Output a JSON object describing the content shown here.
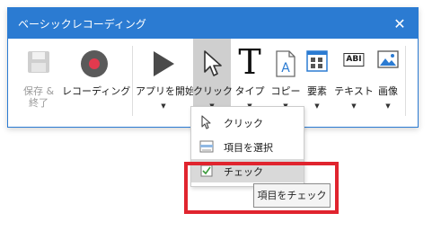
{
  "window": {
    "title": "ベーシックレコーディング",
    "close_glyph": "✕",
    "accent": "#2b7bd2"
  },
  "toolbar": {
    "save_end": {
      "label_1": "保存 &",
      "label_2": "終了",
      "icon": "save-icon",
      "enabled": false
    },
    "recording": {
      "label": "レコーディング",
      "icon": "record-icon"
    },
    "app_launch": {
      "label": "アプリを開始",
      "icon": "play-icon"
    },
    "click": {
      "label": "クリック",
      "icon": "cursor-icon",
      "pressed": true
    },
    "type": {
      "label": "タイプ",
      "icon": "type-T-icon",
      "glyph": "T"
    },
    "copy": {
      "label": "コピー",
      "icon": "copy-document-icon"
    },
    "element": {
      "label": "要素",
      "icon": "element-grid-icon"
    },
    "text": {
      "label": "テキスト",
      "icon": "abi-text-icon",
      "glyph": "ABI"
    },
    "image": {
      "label": "画像",
      "icon": "image-icon"
    },
    "dropdown_arrow": "▼"
  },
  "click_menu": {
    "items": [
      {
        "label": "クリック",
        "icon": "cursor-icon"
      },
      {
        "label": "項目を選択",
        "icon": "select-list-icon"
      },
      {
        "label": "チェック",
        "icon": "checkbox-icon",
        "hovered": true
      }
    ]
  },
  "tooltip": {
    "text": "項目をチェック"
  },
  "highlight_color": "#e0242e"
}
